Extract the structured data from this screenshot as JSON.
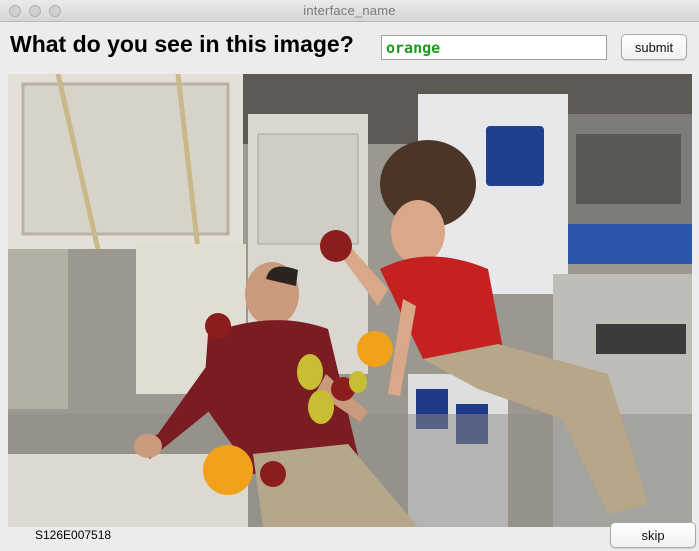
{
  "window": {
    "title": "interface_name"
  },
  "prompt": {
    "question": "What do you see in this image?"
  },
  "answer": {
    "value": "orange",
    "text_color": "#1f9a1f"
  },
  "buttons": {
    "submit_label": "submit",
    "skip_label": "skip"
  },
  "image": {
    "id_label": "S126E007518"
  }
}
